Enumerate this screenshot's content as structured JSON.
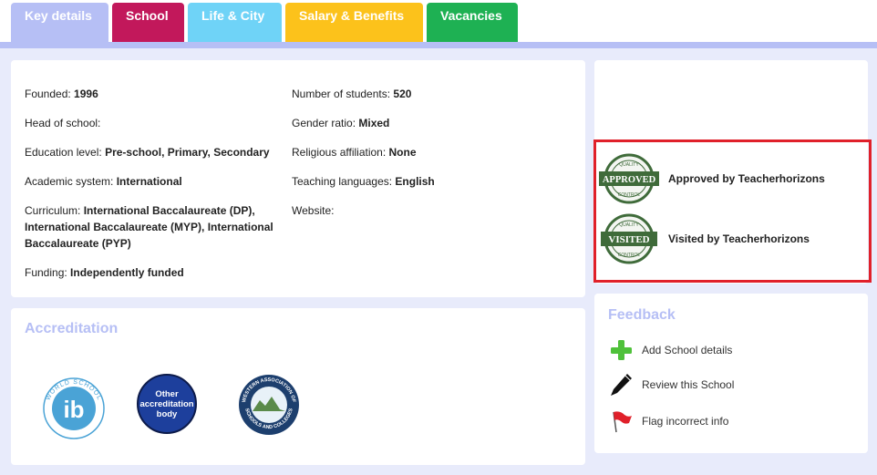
{
  "tabs": [
    "Key details",
    "School",
    "Life & City",
    "Salary & Benefits",
    "Vacancies"
  ],
  "key_details": {
    "left": [
      {
        "label": "Founded: ",
        "value": "1996"
      },
      {
        "label": "Head of school:",
        "value": ""
      },
      {
        "label": "Education level: ",
        "value": "Pre-school, Primary, Secondary"
      },
      {
        "label": "Academic system: ",
        "value": "International"
      },
      {
        "label": "Curriculum: ",
        "value": "International Baccalaureate (DP), International Baccalaureate (MYP), International Baccalaureate (PYP)"
      },
      {
        "label": "Funding: ",
        "value": "Independently funded"
      }
    ],
    "right": [
      {
        "label": "Number of students: ",
        "value": "520"
      },
      {
        "label": "Gender ratio: ",
        "value": "Mixed"
      },
      {
        "label": "Religious affiliation: ",
        "value": "None"
      },
      {
        "label": "Teaching languages: ",
        "value": "English"
      },
      {
        "label": "Website:",
        "value": ""
      }
    ]
  },
  "accreditation": {
    "heading": "Accreditation",
    "ib_logo": {
      "text": "ib",
      "ring": "WORLD SCHOOL"
    },
    "other_body": "Other accreditation body",
    "wasc_logo": {
      "ring_top": "WESTERN ASSOCIATION OF",
      "ring_bottom": "SCHOOLS AND COLLEGES"
    }
  },
  "badges": [
    {
      "stamp": "APPROVED",
      "stamp_top": "QUALITY",
      "stamp_bottom": "CONTROL",
      "text": "Approved by Teacherhorizons"
    },
    {
      "stamp": "VISITED",
      "stamp_top": "QUALITY",
      "stamp_bottom": "CONTROL",
      "text": "Visited by Teacherhorizons"
    }
  ],
  "feedback": {
    "heading": "Feedback",
    "items": [
      {
        "icon": "plus-icon",
        "label": "Add School details"
      },
      {
        "icon": "pencil-icon",
        "label": "Review this School"
      },
      {
        "icon": "flag-icon",
        "label": "Flag incorrect info"
      }
    ]
  },
  "colors": {
    "tab_key": "#b6bff5",
    "tab_school": "#c2185b",
    "tab_life": "#6fd3f7",
    "tab_salary": "#fcc21b",
    "tab_vacancies": "#1eb153",
    "highlight": "#e0202a"
  }
}
